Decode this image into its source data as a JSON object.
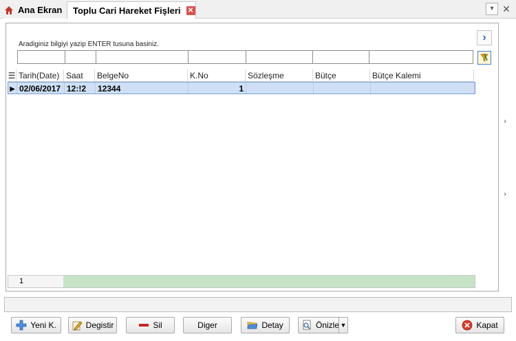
{
  "tabs": {
    "home_label": "Ana Ekran",
    "active_label": "Toplu Cari Hareket Fişleri"
  },
  "search": {
    "hint": "Aradiginiz bilgiyi yazip ENTER tusuna basiniz."
  },
  "grid": {
    "columns": [
      "Tarih(Date)",
      "Saat",
      "BelgeNo",
      "K.No",
      "Sözleşme",
      "Bütçe",
      "Bütçe Kalemi"
    ],
    "rows": [
      {
        "date": "02/06/2017",
        "time": "12:!2",
        "doc_no": "12344",
        "k_no": "1",
        "contract": "",
        "budget": "",
        "budget_item": ""
      }
    ],
    "row_count": "1"
  },
  "buttons": {
    "new": "Yeni K.",
    "edit": "Degistir",
    "delete": "Sil",
    "other": "Diger",
    "detail": "Detay",
    "preview": "Önizle",
    "close": "Kapat"
  },
  "colors": {
    "selected_row": "#cfe0f6",
    "footer_fill": "#c6e3c6",
    "tab_close": "#d9534f"
  }
}
